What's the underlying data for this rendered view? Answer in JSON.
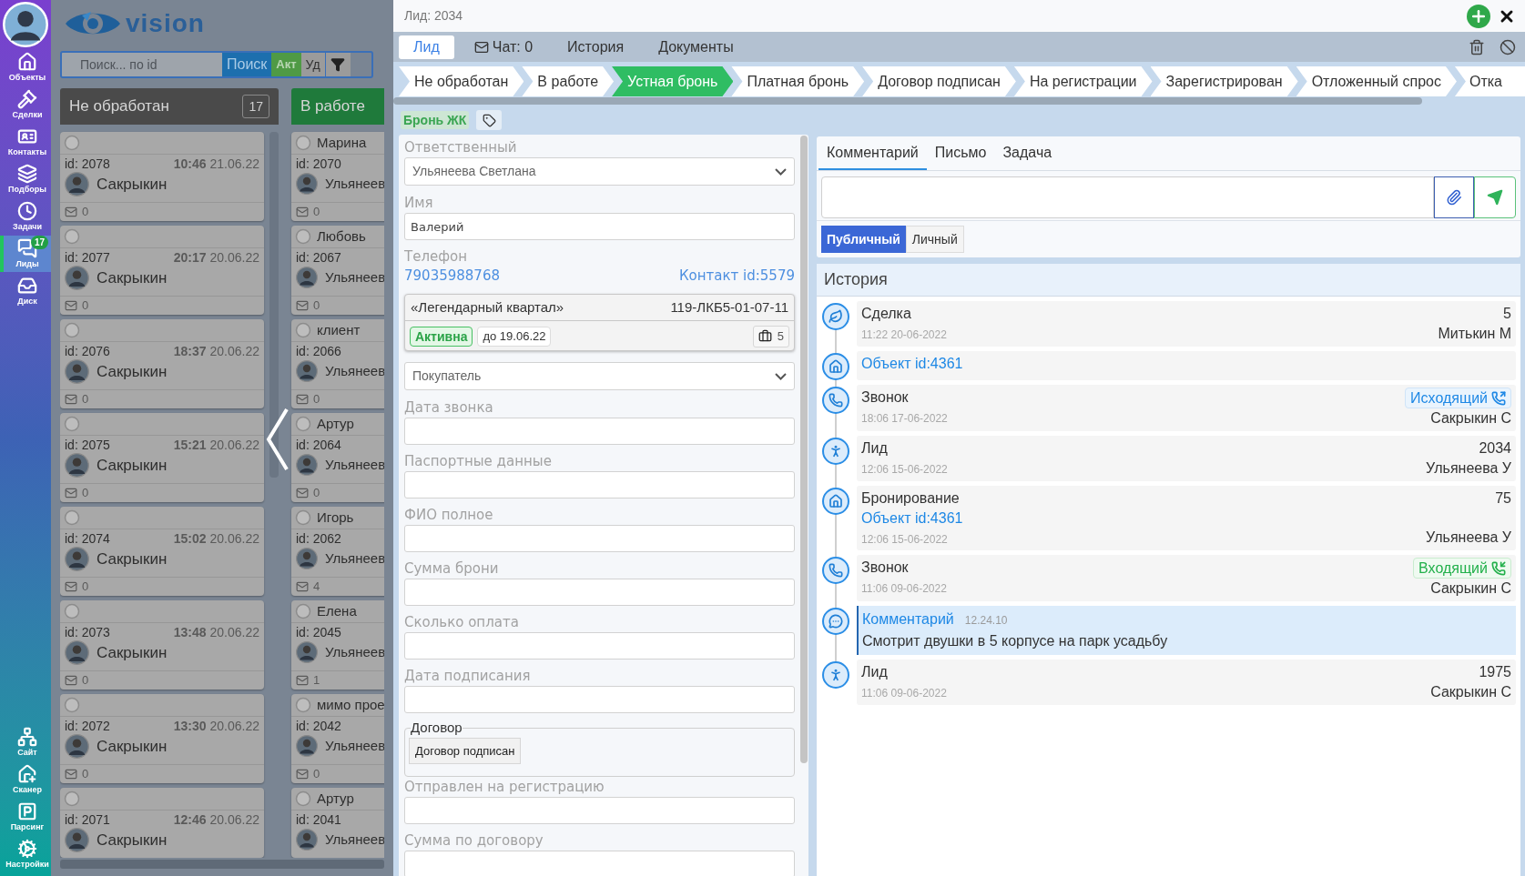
{
  "nav": {
    "top": [
      {
        "label": "Объекты",
        "selected": false
      },
      {
        "label": "Сделки",
        "selected": false
      },
      {
        "label": "Контакты",
        "selected": false
      },
      {
        "label": "Подборы",
        "selected": false
      },
      {
        "label": "Задачи",
        "selected": false
      },
      {
        "label": "Лиды",
        "selected": true,
        "badge": "17"
      },
      {
        "label": "Диск",
        "selected": false
      }
    ],
    "bottom": [
      {
        "label": "Сайт",
        "selected": false
      },
      {
        "label": "Сканер",
        "selected": false
      },
      {
        "label": "Парсинг",
        "selected": false
      },
      {
        "label": "Настройки",
        "selected": false
      }
    ]
  },
  "board": {
    "logo": "vision",
    "search": {
      "placeholder": "Поиск... по id"
    },
    "buttons": [
      {
        "label": "Поиск",
        "kind": "search"
      },
      {
        "label": "Акт",
        "kind": "active"
      },
      {
        "label": "Уд",
        "kind": "deleted"
      }
    ],
    "columns": [
      {
        "title": "Не обработан",
        "count": "17",
        "color": "#4a4a4a",
        "cards": [
          {
            "id": "id: 2078",
            "time": "10:46",
            "date": "21.06.22",
            "person": "Сакрыкин",
            "messages": "0"
          },
          {
            "id": "id: 2077",
            "time": "20:17",
            "date": "20.06.22",
            "person": "Сакрыкин",
            "messages": "0"
          },
          {
            "id": "id: 2076",
            "time": "18:37",
            "date": "20.06.22",
            "person": "Сакрыкин",
            "messages": "0"
          },
          {
            "id": "id: 2075",
            "time": "15:21",
            "date": "20.06.22",
            "person": "Сакрыкин",
            "messages": "0"
          },
          {
            "id": "id: 2074",
            "time": "15:02",
            "date": "20.06.22",
            "person": "Сакрыкин",
            "messages": "0"
          },
          {
            "id": "id: 2073",
            "time": "13:48",
            "date": "20.06.22",
            "person": "Сакрыкин",
            "messages": "0"
          },
          {
            "id": "id: 2072",
            "time": "13:30",
            "date": "20.06.22",
            "person": "Сакрыкин",
            "messages": "0"
          },
          {
            "id": "id: 2071",
            "time": "12:46",
            "date": "20.06.22",
            "person": "Сакрыкин"
          }
        ]
      },
      {
        "title": "В работе",
        "color": "#1f7a3b",
        "cards": [
          {
            "name": "Марина",
            "id": "id: 2070",
            "person": "Ульянеев",
            "messages": "0"
          },
          {
            "name": "Любовь",
            "id": "id: 2067",
            "person": "Ульянеев",
            "messages": "0"
          },
          {
            "name": "клиент",
            "id": "id: 2066",
            "person": "Ульянеев",
            "messages": "0"
          },
          {
            "name": "Артур",
            "id": "id: 2064",
            "person": "Ульянеев",
            "messages": "0"
          },
          {
            "name": "Игорь",
            "id": "id: 2062",
            "person": "Ульянеев",
            "messages": "4"
          },
          {
            "name": "Елена",
            "id": "id: 2045",
            "person": "Ульянеев",
            "messages": "1"
          },
          {
            "name": "мимо прое",
            "id": "id: 2042",
            "person": "Ульянеев",
            "messages": "0"
          },
          {
            "name": "Артур",
            "id": "id: 2041",
            "person": "Ульянеев"
          }
        ]
      }
    ]
  },
  "lead": {
    "title": "Лид: 2034",
    "tabs": [
      {
        "label": "Лид",
        "selected": true
      },
      {
        "label": "Чат: 0",
        "selected": false,
        "kind": "chat"
      },
      {
        "label": "История",
        "selected": false
      },
      {
        "label": "Документы",
        "selected": false
      }
    ],
    "stages": [
      {
        "label": "Не обработан",
        "selected": false
      },
      {
        "label": "В работе",
        "selected": false
      },
      {
        "label": "Устная бронь",
        "selected": true
      },
      {
        "label": "Платная бронь",
        "selected": false
      },
      {
        "label": "Договор подписан",
        "selected": false
      },
      {
        "label": "На регистрации",
        "selected": false
      },
      {
        "label": "Зарегистрирован",
        "selected": false
      },
      {
        "label": "Отложенный спрос",
        "selected": false
      },
      {
        "label": "Отка",
        "selected": false
      }
    ],
    "tags": [
      "Бронь ЖК"
    ],
    "form": [
      {
        "kind": "select",
        "label": "Ответственный",
        "value": "Ульянеева Светлана"
      },
      {
        "kind": "text",
        "label": "Имя",
        "value": "Валерий"
      },
      {
        "kind": "phone",
        "label": "Телефон",
        "phone": "79035988768",
        "contact": "Контакт id:5579"
      },
      {
        "kind": "object",
        "name": "«Легендарный квартал»",
        "code": "119-ЛКБ5-01-07-11",
        "status": "Активна",
        "until": "до 19.06.22",
        "count": "5"
      },
      {
        "kind": "select",
        "value": "Покупатель"
      },
      {
        "kind": "text",
        "label": "Дата звонка"
      },
      {
        "kind": "text",
        "label": "Паспортные данные"
      },
      {
        "kind": "text",
        "label": "ФИО полное"
      },
      {
        "kind": "text",
        "label": "Сумма брони"
      },
      {
        "kind": "text",
        "label": "Сколько оплата"
      },
      {
        "kind": "text",
        "label": "Дата подписания"
      },
      {
        "kind": "group",
        "label": "Договор",
        "button": "Договор подписан"
      },
      {
        "kind": "text",
        "label": "Отправлен на регистрацию"
      },
      {
        "kind": "text",
        "label": "Сумма по договору"
      }
    ],
    "compose": {
      "tabs": [
        {
          "label": "Комментарий",
          "selected": true
        },
        {
          "label": "Письмо",
          "selected": false
        },
        {
          "label": "Задача",
          "selected": false
        }
      ],
      "visibility": [
        {
          "label": "Публичный",
          "selected": true
        },
        {
          "label": "Личный",
          "selected": false
        }
      ]
    },
    "history": {
      "title": "История",
      "items": [
        {
          "kind": "deal",
          "title": "Сделка",
          "time": "11:22 20-06-2022",
          "value": "5",
          "author": "Митькин М"
        },
        {
          "kind": "object",
          "link": "Объект id:4361"
        },
        {
          "kind": "call",
          "title": "Звонок",
          "time": "18:06 17-06-2022",
          "badge": {
            "text": "Исходящий",
            "kind": "outgoing"
          },
          "author": "Сакрыкин С"
        },
        {
          "kind": "lead",
          "title": "Лид",
          "time": "12:06 15-06-2022",
          "value": "2034",
          "author": "Ульянеева У"
        },
        {
          "kind": "booking",
          "title": "Бронирование",
          "link": "Объект id:4361",
          "time": "12:06 15-06-2022",
          "value": "75",
          "author": "Ульянеева У"
        },
        {
          "kind": "call",
          "title": "Звонок",
          "time": "11:06 09-06-2022",
          "badge": {
            "text": "Входящий",
            "kind": "incoming"
          },
          "author": "Сакрыкин С"
        },
        {
          "kind": "comment",
          "title": "Комментарий",
          "time": "12.24.10",
          "text": "Смотрит двушки в 5 корпусе на парк усадьбу"
        },
        {
          "kind": "lead",
          "title": "Лид",
          "time": "11:06 09-06-2022",
          "value": "1975",
          "author": "Сакрыкин С"
        }
      ]
    }
  }
}
